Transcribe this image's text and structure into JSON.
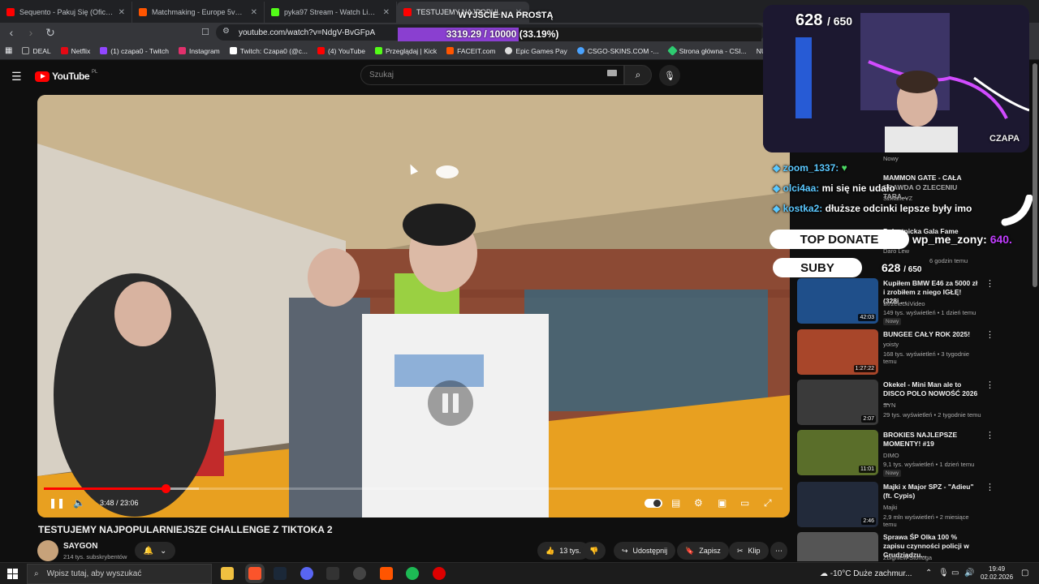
{
  "browser": {
    "tabs": [
      {
        "title": "Sequento - Pakuj Się (Oficjalny Te",
        "color": "#ff0000"
      },
      {
        "title": "Matchmaking - Europe 5v5 Queue -",
        "color": "#ff5500"
      },
      {
        "title": "pyka97 Stream - Watch Live on Kick",
        "color": "#53fc18"
      },
      {
        "title": "TESTUJEMY NAJPOPULARNI",
        "color": "#ff0000"
      }
    ],
    "url": "youtube.com/watch?v=NdgV-BvGFpA",
    "bookmarks": [
      {
        "label": "DEAL",
        "color": "#aaaaaa"
      },
      {
        "label": "Netflix",
        "color": "#e50914"
      },
      {
        "label": "(1) czapa0 - Twitch",
        "color": "#9146ff"
      },
      {
        "label": "Instagram",
        "color": "#e1306c"
      },
      {
        "label": "Twitch: Czapa0 (@c...",
        "color": "#ffffff"
      },
      {
        "label": "(4) YouTube",
        "color": "#ff0000"
      },
      {
        "label": "Przeglądaj | Kick",
        "color": "#53fc18"
      },
      {
        "label": "FACEIT.com",
        "color": "#ff5500"
      },
      {
        "label": "Epic Games Pay",
        "color": "#dddddd"
      },
      {
        "label": "CSGO-SKINS.COM -...",
        "color": "#4aa3ff"
      },
      {
        "label": "Strona główna - CSI...",
        "color": "#2ecc71"
      },
      {
        "label": "NUBI",
        "color": "#35363a"
      }
    ]
  },
  "youtube": {
    "logo_text": "YouTube",
    "logo_country": "PL",
    "search_placeholder": "Szukaj",
    "player": {
      "time": "3:48 / 23:06",
      "played_fraction": 0.165,
      "buffered_fraction": 0.21
    },
    "video_title": "TESTUJEMY NAJPOPULARNIEJSZE CHALLENGE Z TIKTOKA 2",
    "channel": {
      "name": "SAYGON",
      "subs": "214 tys. subskrybentów"
    },
    "actions": {
      "likes": "13 tys.",
      "share": "Udostępnij",
      "save": "Zapisz",
      "clip": "Klip"
    },
    "recommendations": [
      {
        "title": "Kupiłem BMW E46 za 5000 zł i zrobiłem z niego IGŁĘ! (328i ...",
        "channel": "StrzeleckiVideo",
        "meta": "149 tys. wyświetleń • 1 dzień temu",
        "badge": "Nowy",
        "duration": "42:03",
        "color": "#1f4f8a"
      },
      {
        "title": "BUNGEE CAŁY ROK 2025!",
        "channel": "yoisty",
        "meta": "168 tys. wyświetleń • 3 tygodnie temu",
        "badge": "",
        "duration": "1:27:22",
        "color": "#a8462a"
      },
      {
        "title": "Okekel - Mini Man ale to DISCO POLO NOWOŚĆ 2026 ...",
        "channel": "SYN",
        "meta": "29 tys. wyświetleń • 2 tygodnie temu",
        "badge": "",
        "duration": "2:07",
        "color": "#3a3a3a"
      },
      {
        "title": "BROKIES NAJLEPSZE MOMENTY! #19",
        "channel": "DIMO",
        "meta": "9,1 tys. wyświetleń • 1 dzień temu",
        "badge": "Nowy",
        "duration": "11:01",
        "color": "#5a6e2a"
      },
      {
        "title": "Majki x Major SPZ - \"Adieu\" (ft. Cypis)",
        "channel": "Majki",
        "meta": "2,9 mln wyświetleń • 2 miesiące temu",
        "badge": "",
        "duration": "2:46",
        "color": "#222a3a"
      },
      {
        "title": "Sprawa ŚP Olka 100 % zapisu czynności policji w Grudziądzu...",
        "channel": "Zbigniew Stonoga",
        "meta": "",
        "badge": "",
        "duration": "",
        "color": "#555555"
      }
    ],
    "partial_recs": {
      "r1_channel": "Nowy",
      "r2_title": "MAMMON GATE - CAŁA",
      "r2_sub": "PRAWDA O ZLECENIU TARA...",
      "r2_channel": "SzklaneVZ",
      "r3_title": "Polsatnicka Gala Fame",
      "r3_channel": "Daro Lew",
      "r3_meta": "6 godzin temu"
    }
  },
  "stream_overlay": {
    "goal_label": "WYJŚCIE NA PROSTĄ",
    "goal_text": "3319.29 / 10000 (33.19%)",
    "goal_fraction": 0.3319,
    "webcam_count": "628",
    "webcam_total": "/ 650",
    "webcam_label": "CZAPA",
    "chat": [
      {
        "user": "zoom_1337:",
        "message": ""
      },
      {
        "user": "olci4aa:",
        "message": "mi się nie udało"
      },
      {
        "user": "kostka2:",
        "message": "dłuższe odcinki lepsze były imo"
      }
    ],
    "top_donate_label": "TOP DONATE",
    "top_donor": "wp_me_zony:",
    "top_donor_amount": "640.",
    "subs_label": "SUBY",
    "subs_count": "628",
    "subs_total": "/ 650"
  },
  "taskbar": {
    "search_placeholder": "Wpisz tutaj, aby wyszukać",
    "weather": "-10°C  Duże zachmur...",
    "time": "19:49",
    "date": "02.02.2026"
  }
}
